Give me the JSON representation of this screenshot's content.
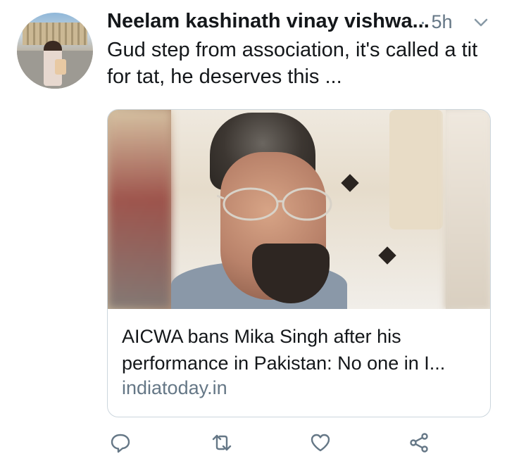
{
  "tweet": {
    "author": "Neelam kashinath vinay vishwa...",
    "timestamp": "· 5h",
    "text": "Gud step from association, it's called a tit for tat, he deserves this ..."
  },
  "card": {
    "title": "AICWA bans Mika Singh after his performance in Pakistan: No one in I...",
    "domain": "indiatoday.in"
  },
  "icons": {
    "menu": "chevron-down-icon",
    "reply": "reply-icon",
    "retweet": "retweet-icon",
    "like": "heart-icon",
    "share": "share-icon"
  },
  "colors": {
    "secondary_text": "#657786",
    "primary_text": "#14171a",
    "border": "#ccd6dd"
  }
}
